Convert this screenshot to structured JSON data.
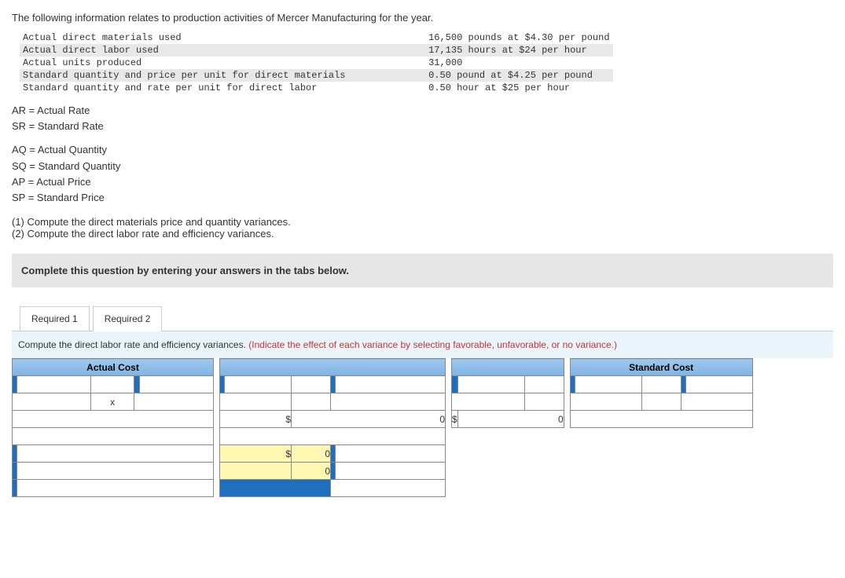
{
  "intro": "The following information relates to production activities of Mercer Manufacturing for the year.",
  "rows": [
    {
      "label": "Actual direct materials used",
      "value": "16,500 pounds at $4.30 per pound",
      "shaded": false
    },
    {
      "label": "Actual direct labor used",
      "value": "17,135 hours at $24 per hour",
      "shaded": true
    },
    {
      "label": "Actual units produced",
      "value": "31,000",
      "shaded": false
    },
    {
      "label": "Standard quantity and price per unit for direct materials",
      "value": "0.50 pound at $4.25 per pound",
      "shaded": true
    },
    {
      "label": "Standard quantity and rate per unit for direct labor",
      "value": "0.50 hour at $25 per hour",
      "shaded": false
    }
  ],
  "defs1": [
    "AR = Actual Rate",
    "SR = Standard Rate"
  ],
  "defs2": [
    "AQ = Actual Quantity",
    "SQ = Standard Quantity",
    "AP = Actual Price",
    "SP = Standard Price"
  ],
  "q1": "(1) Compute the direct materials price and quantity variances.",
  "q2": "(2) Compute the direct labor rate and efficiency variances.",
  "instruction": "Complete this question by entering your answers in the tabs below.",
  "tabs": {
    "t1": "Required 1",
    "t2": "Required 2"
  },
  "tabPrompt": "Compute the direct labor rate and efficiency variances. ",
  "tabHint": "(Indicate the effect of each variance by selecting favorable, unfavorable, or no variance.)",
  "headers": {
    "actual": "Actual Cost",
    "standard": "Standard Cost"
  },
  "symbols": {
    "times": "x",
    "dollar": "$"
  },
  "values": {
    "zero": "0"
  }
}
